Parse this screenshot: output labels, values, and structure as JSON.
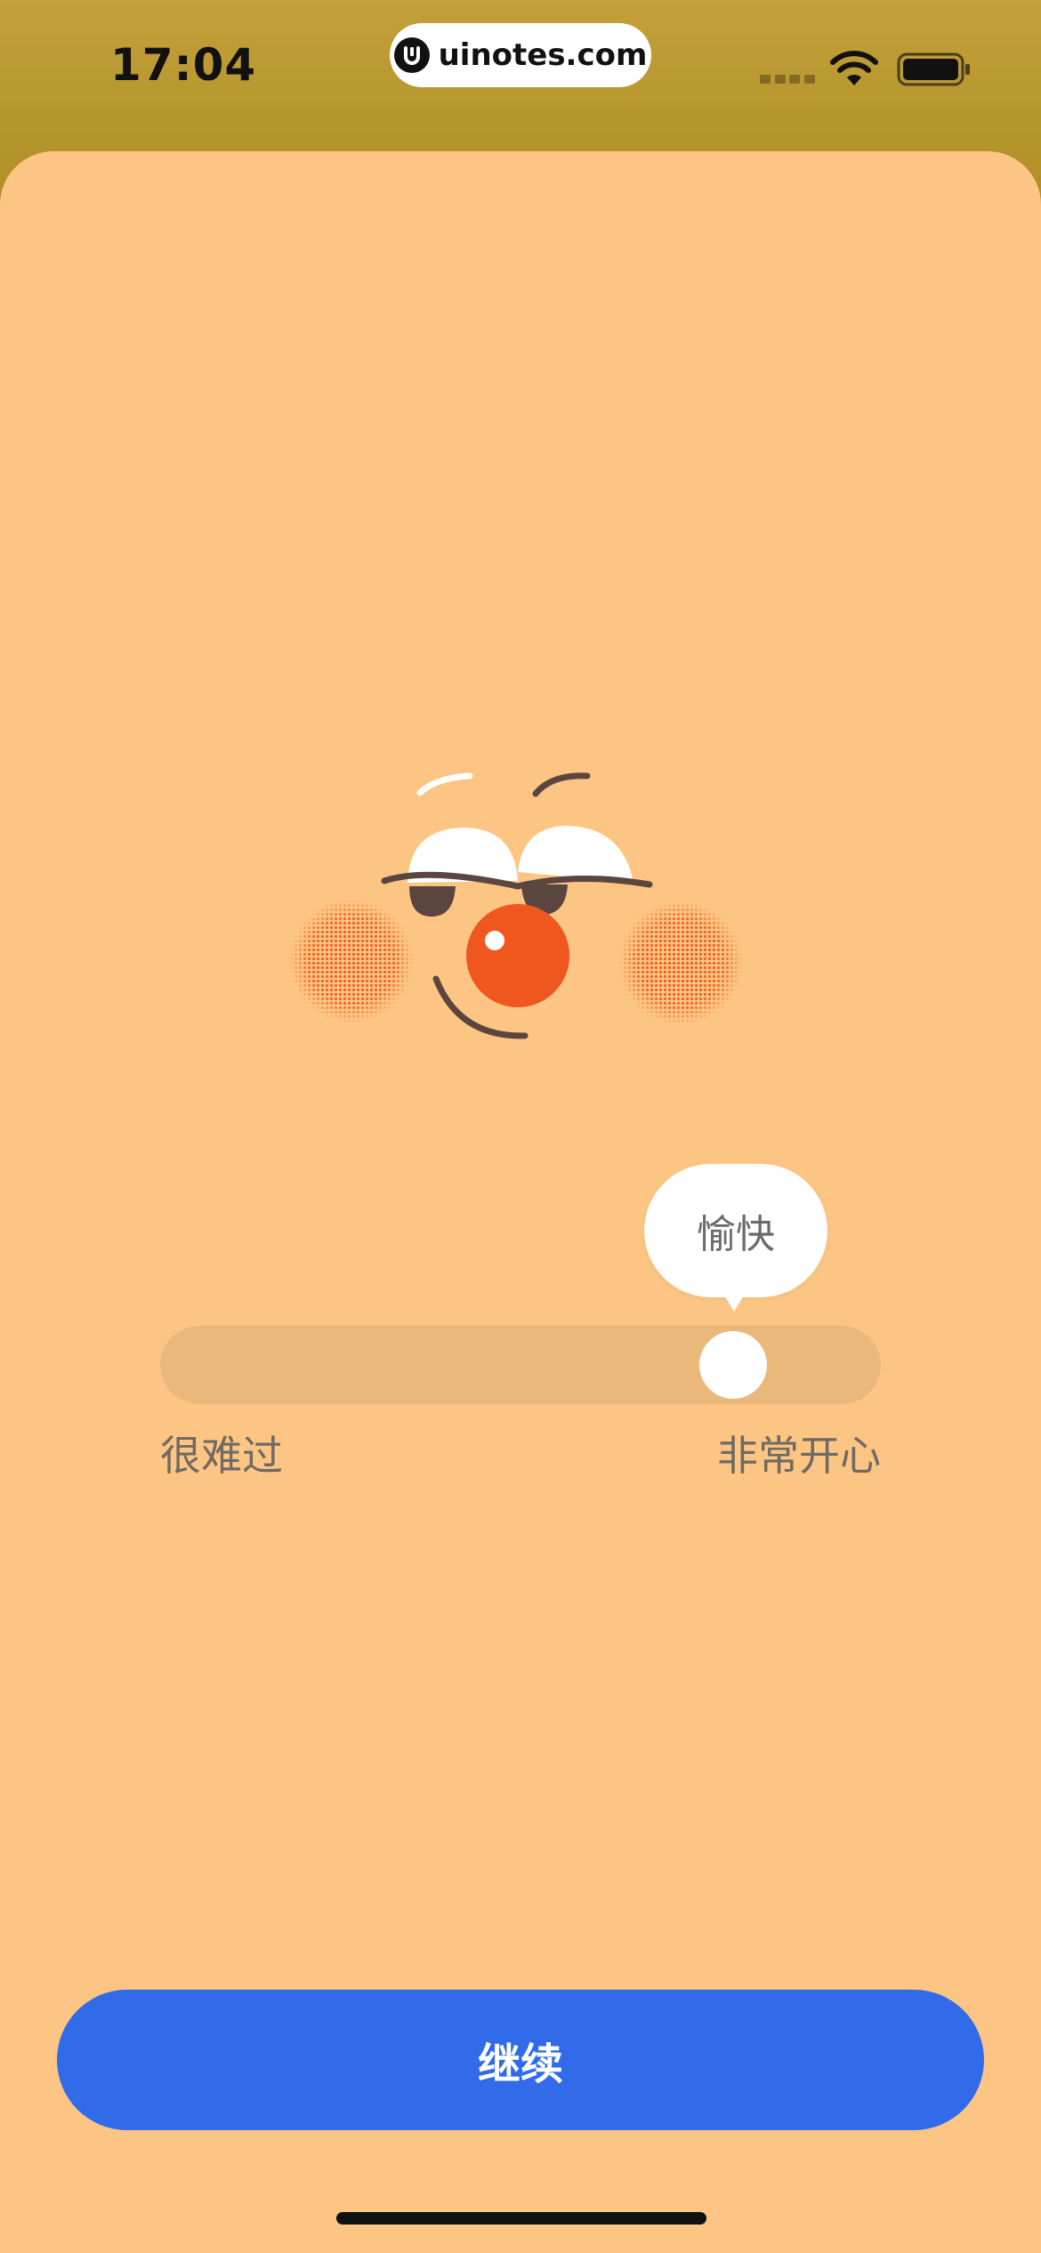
{
  "status_bar": {
    "time": "17:04",
    "url": "uinotes.com"
  },
  "mood": {
    "current_label": "愉快",
    "min_label": "很难过",
    "max_label": "非常开心",
    "level_fraction": 0.8
  },
  "actions": {
    "continue_label": "继续"
  },
  "colors": {
    "sheet_background": "#fdc583",
    "primary_button": "#316bea",
    "slider_track": "#ebb87c",
    "nose": "#f0571f"
  },
  "icons": {
    "url_logo": "uinotes-logo-icon",
    "wifi": "wifi-icon",
    "battery": "battery-icon",
    "mood_face": "mood-face-illustration"
  }
}
